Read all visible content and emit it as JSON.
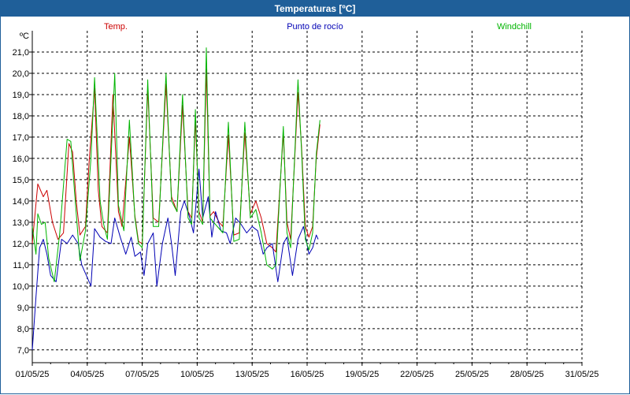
{
  "window": {
    "title": "Temperaturas [ºC]"
  },
  "chart_data": {
    "type": "line",
    "title": "Temperaturas [ºC]",
    "ylabel": "ºC",
    "ylim": [
      6.4,
      22.0
    ],
    "yticks": [
      "7,0",
      "8,0",
      "9,0",
      "10,0",
      "11,0",
      "12,0",
      "13,0",
      "14,0",
      "15,0",
      "16,0",
      "17,0",
      "18,0",
      "19,0",
      "20,0",
      "21,0"
    ],
    "xticks": [
      "01/05/25",
      "04/05/25",
      "07/05/25",
      "10/05/25",
      "13/05/25",
      "16/05/25",
      "19/05/25",
      "22/05/25",
      "25/05/25",
      "28/05/25",
      "31/05/25"
    ],
    "x_range_days": [
      1,
      31
    ],
    "legend_placement": "top",
    "grid": true,
    "series": [
      {
        "name": "Temp.",
        "color": "#cc0000",
        "points": [
          [
            1.0,
            12.0
          ],
          [
            1.3,
            14.8
          ],
          [
            1.6,
            14.2
          ],
          [
            1.8,
            14.5
          ],
          [
            2.1,
            13.0
          ],
          [
            2.4,
            12.2
          ],
          [
            2.7,
            12.5
          ],
          [
            3.0,
            16.7
          ],
          [
            3.2,
            16.3
          ],
          [
            3.4,
            14.0
          ],
          [
            3.6,
            12.4
          ],
          [
            3.9,
            12.8
          ],
          [
            4.1,
            15.8
          ],
          [
            4.4,
            19.3
          ],
          [
            4.6,
            14.5
          ],
          [
            4.8,
            12.8
          ],
          [
            5.1,
            12.5
          ],
          [
            5.4,
            19.0
          ],
          [
            5.7,
            13.5
          ],
          [
            5.9,
            12.8
          ],
          [
            6.3,
            17.0
          ],
          [
            6.6,
            13.3
          ],
          [
            6.8,
            12.1
          ],
          [
            7.0,
            12.0
          ],
          [
            7.3,
            19.3
          ],
          [
            7.6,
            13.2
          ],
          [
            7.9,
            13.0
          ],
          [
            8.3,
            19.5
          ],
          [
            8.6,
            14.2
          ],
          [
            8.9,
            13.5
          ],
          [
            9.2,
            18.5
          ],
          [
            9.5,
            13.5
          ],
          [
            9.7,
            13.2
          ],
          [
            9.9,
            17.8
          ],
          [
            10.1,
            13.5
          ],
          [
            10.3,
            13.0
          ],
          [
            10.5,
            20.2
          ],
          [
            10.7,
            13.3
          ],
          [
            10.9,
            13.5
          ],
          [
            11.2,
            13.0
          ],
          [
            11.4,
            12.8
          ],
          [
            11.7,
            17.1
          ],
          [
            12.0,
            12.4
          ],
          [
            12.3,
            12.5
          ],
          [
            12.6,
            17.2
          ],
          [
            12.9,
            13.4
          ],
          [
            13.2,
            14.0
          ],
          [
            13.5,
            13.2
          ],
          [
            13.8,
            12.0
          ],
          [
            14.1,
            11.8
          ],
          [
            14.3,
            11.6
          ],
          [
            14.7,
            17.2
          ],
          [
            14.9,
            13.0
          ],
          [
            15.1,
            12.2
          ],
          [
            15.5,
            19.1
          ],
          [
            15.7,
            16.5
          ],
          [
            15.9,
            12.8
          ],
          [
            16.1,
            12.3
          ],
          [
            16.3,
            12.8
          ],
          [
            16.5,
            16.0
          ],
          [
            16.7,
            17.6
          ]
        ]
      },
      {
        "name": "Punto de rocío",
        "color": "#0000b4",
        "points": [
          [
            1.0,
            7.0
          ],
          [
            1.2,
            9.5
          ],
          [
            1.4,
            11.8
          ],
          [
            1.6,
            12.2
          ],
          [
            1.8,
            11.5
          ],
          [
            2.0,
            10.5
          ],
          [
            2.3,
            10.2
          ],
          [
            2.6,
            12.2
          ],
          [
            2.9,
            12.0
          ],
          [
            3.2,
            12.4
          ],
          [
            3.5,
            12.0
          ],
          [
            3.7,
            11.0
          ],
          [
            3.9,
            10.6
          ],
          [
            4.2,
            10.0
          ],
          [
            4.4,
            12.7
          ],
          [
            4.7,
            12.3
          ],
          [
            5.0,
            12.1
          ],
          [
            5.3,
            12.0
          ],
          [
            5.5,
            13.2
          ],
          [
            5.8,
            12.3
          ],
          [
            6.1,
            11.5
          ],
          [
            6.4,
            12.3
          ],
          [
            6.6,
            11.4
          ],
          [
            6.9,
            11.6
          ],
          [
            7.1,
            10.5
          ],
          [
            7.3,
            12.0
          ],
          [
            7.6,
            12.5
          ],
          [
            7.8,
            10.0
          ],
          [
            8.1,
            12.0
          ],
          [
            8.4,
            13.2
          ],
          [
            8.6,
            12.0
          ],
          [
            8.8,
            10.5
          ],
          [
            9.1,
            13.5
          ],
          [
            9.3,
            14.0
          ],
          [
            9.6,
            13.2
          ],
          [
            9.8,
            12.5
          ],
          [
            10.1,
            15.5
          ],
          [
            10.3,
            13.2
          ],
          [
            10.6,
            14.2
          ],
          [
            10.8,
            12.3
          ],
          [
            11.0,
            13.5
          ],
          [
            11.3,
            12.6
          ],
          [
            11.6,
            12.5
          ],
          [
            11.8,
            12.0
          ],
          [
            12.1,
            13.2
          ],
          [
            12.4,
            12.9
          ],
          [
            12.7,
            12.5
          ],
          [
            13.0,
            12.8
          ],
          [
            13.3,
            12.6
          ],
          [
            13.6,
            11.5
          ],
          [
            13.8,
            11.8
          ],
          [
            14.1,
            12.0
          ],
          [
            14.4,
            10.2
          ],
          [
            14.7,
            12.0
          ],
          [
            14.9,
            12.3
          ],
          [
            15.2,
            10.5
          ],
          [
            15.5,
            12.2
          ],
          [
            15.8,
            12.8
          ],
          [
            16.1,
            11.5
          ],
          [
            16.3,
            11.8
          ],
          [
            16.5,
            12.4
          ],
          [
            16.6,
            12.2
          ]
        ]
      },
      {
        "name": "Windchill",
        "color": "#00b400",
        "points": [
          [
            1.0,
            12.8
          ],
          [
            1.2,
            11.5
          ],
          [
            1.3,
            13.4
          ],
          [
            1.5,
            12.9
          ],
          [
            1.7,
            13.0
          ],
          [
            1.9,
            11.3
          ],
          [
            2.2,
            10.2
          ],
          [
            2.5,
            12.5
          ],
          [
            2.9,
            16.9
          ],
          [
            3.1,
            16.8
          ],
          [
            3.3,
            14.5
          ],
          [
            3.6,
            11.2
          ],
          [
            3.9,
            12.6
          ],
          [
            4.2,
            16.0
          ],
          [
            4.4,
            19.8
          ],
          [
            4.7,
            14.0
          ],
          [
            4.9,
            12.9
          ],
          [
            5.1,
            12.2
          ],
          [
            5.3,
            16.0
          ],
          [
            5.5,
            20.0
          ],
          [
            5.7,
            13.8
          ],
          [
            6.0,
            12.6
          ],
          [
            6.3,
            17.8
          ],
          [
            6.6,
            13.2
          ],
          [
            6.8,
            12.0
          ],
          [
            7.0,
            11.8
          ],
          [
            7.3,
            19.7
          ],
          [
            7.6,
            12.8
          ],
          [
            7.9,
            12.8
          ],
          [
            8.3,
            20.0
          ],
          [
            8.6,
            14.0
          ],
          [
            8.9,
            13.5
          ],
          [
            9.2,
            19.0
          ],
          [
            9.5,
            13.2
          ],
          [
            9.7,
            12.9
          ],
          [
            9.9,
            18.3
          ],
          [
            10.1,
            13.2
          ],
          [
            10.3,
            12.9
          ],
          [
            10.5,
            21.2
          ],
          [
            10.7,
            13.2
          ],
          [
            10.9,
            13.0
          ],
          [
            11.2,
            12.7
          ],
          [
            11.4,
            12.5
          ],
          [
            11.7,
            17.7
          ],
          [
            12.0,
            12.1
          ],
          [
            12.3,
            12.2
          ],
          [
            12.6,
            17.7
          ],
          [
            12.9,
            13.2
          ],
          [
            13.2,
            13.6
          ],
          [
            13.5,
            12.5
          ],
          [
            13.8,
            11.0
          ],
          [
            14.1,
            10.8
          ],
          [
            14.3,
            11.0
          ],
          [
            14.7,
            17.5
          ],
          [
            14.9,
            12.5
          ],
          [
            15.1,
            11.8
          ],
          [
            15.5,
            19.7
          ],
          [
            15.7,
            16.3
          ],
          [
            15.9,
            12.2
          ],
          [
            16.1,
            11.7
          ],
          [
            16.3,
            12.5
          ],
          [
            16.5,
            16.2
          ],
          [
            16.7,
            17.8
          ]
        ]
      }
    ]
  }
}
